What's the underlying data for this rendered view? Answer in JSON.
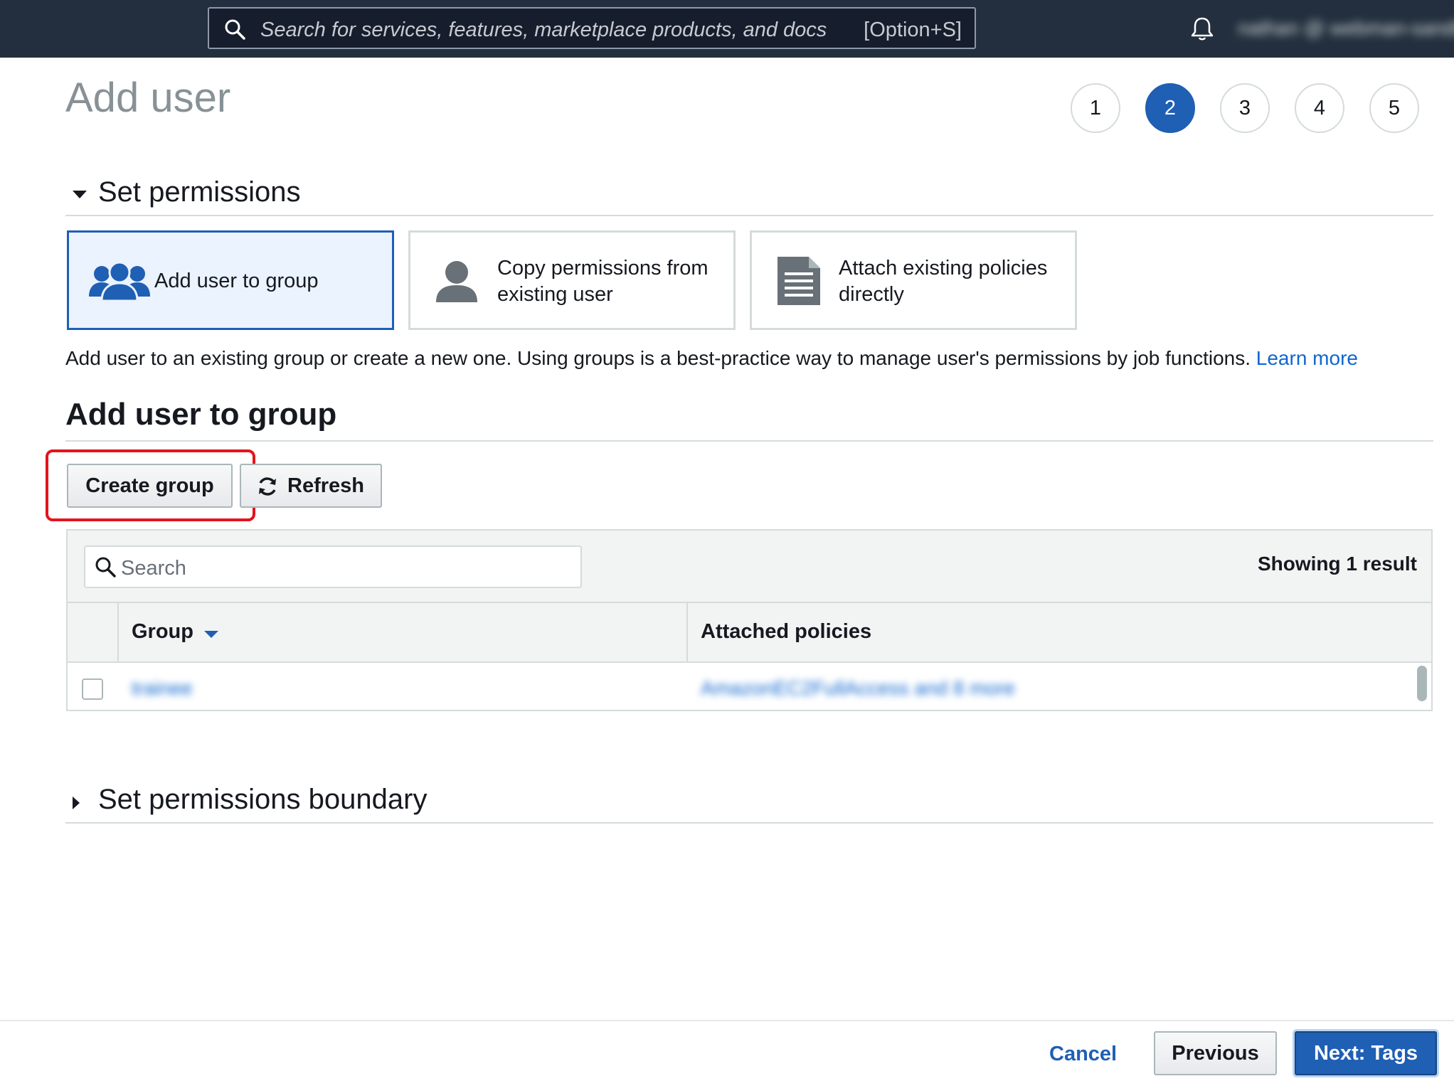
{
  "topbar": {
    "search_placeholder": "Search for services, features, marketplace products, and docs",
    "search_shortcut": "[Option+S]",
    "account_name": "nathan @ webman-sandbox"
  },
  "page": {
    "title": "Add user",
    "steps": [
      "1",
      "2",
      "3",
      "4",
      "5"
    ],
    "active_step": "2"
  },
  "set_permissions": {
    "heading": "Set permissions",
    "options": [
      {
        "label": "Add user to group",
        "icon": "users-group-icon",
        "selected": true
      },
      {
        "label_line1": "Copy permissions from",
        "label_line2": "existing user",
        "icon": "user-icon",
        "selected": false
      },
      {
        "label_line1": "Attach existing policies",
        "label_line2": "directly",
        "icon": "document-icon",
        "selected": false
      }
    ],
    "description": "Add user to an existing group or create a new one. Using groups is a best-practice way to manage user's permissions by job functions.",
    "learn_more": "Learn more"
  },
  "group_section": {
    "title": "Add user to group",
    "create_group_label": "Create group",
    "refresh_label": "Refresh",
    "search_placeholder": "Search",
    "result_count": "Showing 1 result",
    "columns": [
      "Group",
      "Attached policies"
    ],
    "rows": [
      {
        "group": "trainee",
        "policies": "AmazonEC2FullAccess and 8 more"
      }
    ]
  },
  "boundary": {
    "heading": "Set permissions boundary"
  },
  "footer": {
    "cancel": "Cancel",
    "previous": "Previous",
    "next": "Next: Tags"
  },
  "colors": {
    "nav_bg": "#232f3e",
    "primary": "#1f5fb4",
    "link": "#0f66d0",
    "highlight": "#e3141b"
  }
}
